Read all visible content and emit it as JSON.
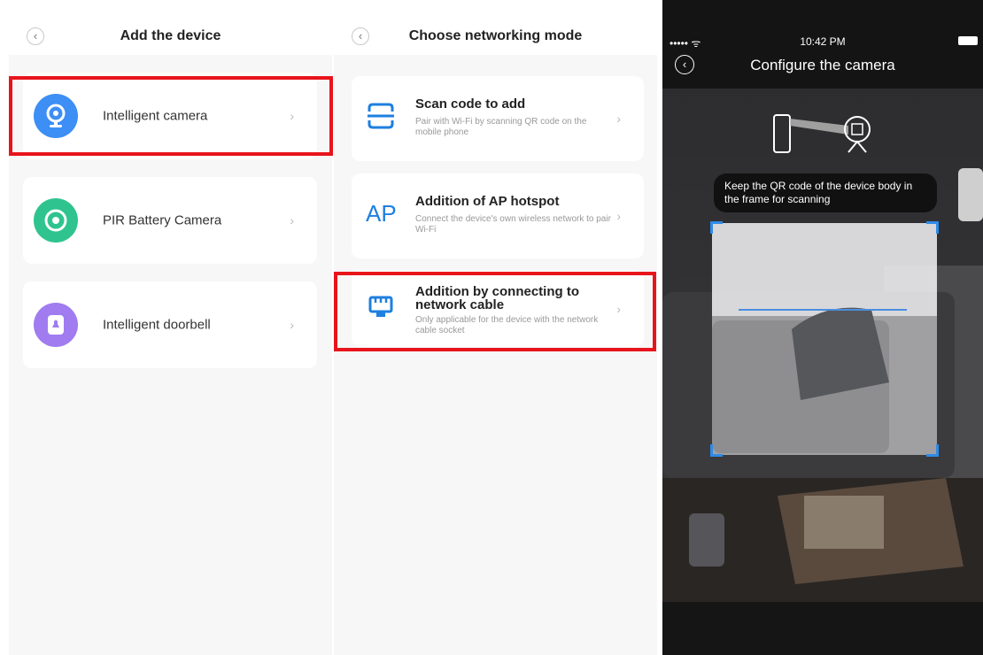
{
  "left_panel": {
    "back_icon": "chevron-left-icon",
    "title": "Add the device",
    "devices": [
      {
        "label": "Intelligent camera",
        "icon": "camera-icon",
        "icon_color": "#3d8ef5"
      },
      {
        "label": "PIR Battery Camera",
        "icon": "camera-icon",
        "icon_color": "#2fc48f"
      },
      {
        "label": "Intelligent doorbell",
        "icon": "doorbell-icon",
        "icon_color": "#a07cf0"
      }
    ]
  },
  "middle_panel": {
    "back_icon": "chevron-left-icon",
    "title": "Choose networking mode",
    "modes": [
      {
        "title": "Scan code to add",
        "description": "Pair with Wi-Fi by scanning QR code on the mobile phone",
        "icon": "scan-icon"
      },
      {
        "title": "Addition of AP hotspot",
        "description": "Connect the device's own wireless network to pair Wi-Fi",
        "icon": "ap-icon",
        "icon_text": "AP"
      },
      {
        "title": "Addition by connecting to network cable",
        "description": "Only applicable for the device with the network cable socket",
        "icon": "ethernet-icon"
      }
    ]
  },
  "right_panel": {
    "status_bar": {
      "signal": "••••• ᯤ",
      "time": "10:42 PM"
    },
    "title": "Configure the camera",
    "tooltip": "Keep the QR code of the device body in the frame for scanning"
  },
  "colors": {
    "highlight": "#e8141b",
    "accent": "#1e7fe0",
    "scan_corner": "#2f8ae8"
  }
}
